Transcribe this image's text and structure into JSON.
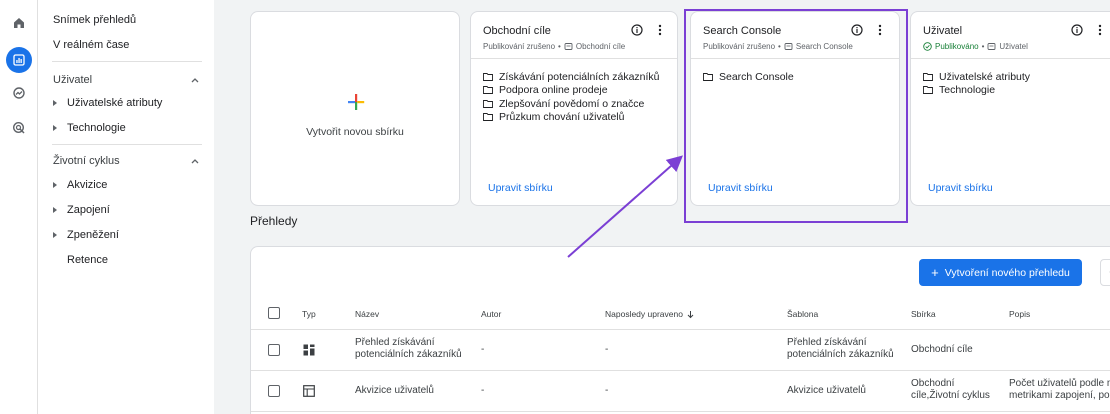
{
  "nav": {
    "top_items": [
      "Snímek přehledů",
      "V reálném čase"
    ],
    "groups": [
      {
        "label": "Uživatel",
        "children": [
          "Uživatelské atributy",
          "Technologie"
        ]
      },
      {
        "label": "Životní cyklus",
        "children": [
          "Akvizice",
          "Zapojení",
          "Zpeněžení"
        ],
        "extra": "Retence"
      }
    ]
  },
  "create_card": {
    "label": "Vytvořit novou sbírku"
  },
  "collections": [
    {
      "title": "Obchodní cíle",
      "status": "Publikování zrušeno",
      "tag": "Obchodní cíle",
      "published": false,
      "items": [
        "Získávání potenciálních zákazníků",
        "Podpora online prodeje",
        "Zlepšování povědomí o značce",
        "Průzkum chování uživatelů"
      ],
      "link": "Upravit sbírku"
    },
    {
      "title": "Search Console",
      "status": "Publikování zrušeno",
      "tag": "Search Console",
      "published": false,
      "items": [
        "Search Console"
      ],
      "link": "Upravit sbírku"
    },
    {
      "title": "Uživatel",
      "status": "Publikováno",
      "tag": "Uživatel",
      "published": true,
      "items": [
        "Uživatelské atributy",
        "Technologie"
      ],
      "link": "Upravit sbírku"
    }
  ],
  "reports": {
    "section_title": "Přehledy",
    "new_button": "Vytvoření nového přehledu",
    "columns": [
      "Typ",
      "Název",
      "Autor",
      "Naposledy upraveno",
      "Šablona",
      "Sbírka",
      "Popis"
    ],
    "rows": [
      {
        "type_icon": "dashboard-icon",
        "name": "Přehled získávání potenciálních zákazníků",
        "author": "-",
        "modified": "-",
        "template": "Přehled získávání potenciálních zákazníků",
        "collection": "Obchodní cíle",
        "description": ""
      },
      {
        "type_icon": "table-icon",
        "name": "Akvizice uživatelů",
        "author": "-",
        "modified": "-",
        "template": "Akvizice uživatelů",
        "collection": "Obchodní cíle,Životní cyklus",
        "description": "Počet uživatelů podle n metrikami zapojení, po"
      }
    ]
  },
  "colors": {
    "accent": "#1a73e8",
    "annotation": "#7b3fd4",
    "published": "#188038"
  }
}
